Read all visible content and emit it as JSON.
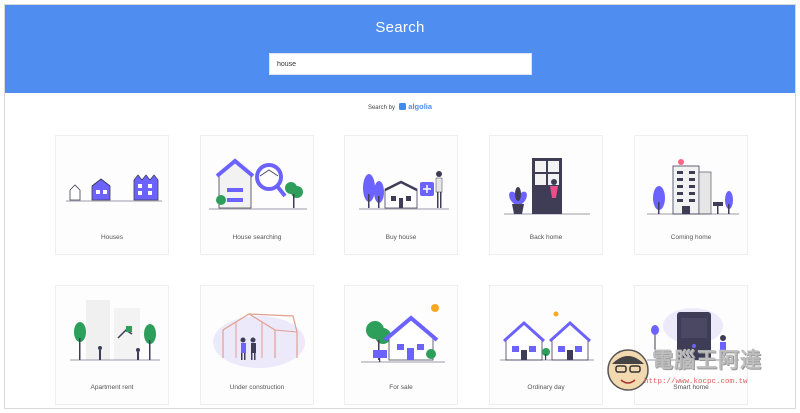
{
  "header": {
    "title": "Search",
    "search_value": "house"
  },
  "powered_by": {
    "prefix": "Search by",
    "brand": "algolia"
  },
  "colors": {
    "header_bg": "#4f8ef0",
    "illustration_accent": "#6c63ff"
  },
  "cards": [
    {
      "label": "Houses",
      "icon": "houses-icon"
    },
    {
      "label": "House searching",
      "icon": "house-searching-icon"
    },
    {
      "label": "Buy house",
      "icon": "buy-house-icon"
    },
    {
      "label": "Back home",
      "icon": "back-home-icon"
    },
    {
      "label": "Coming home",
      "icon": "coming-home-icon"
    },
    {
      "label": "Apartment rent",
      "icon": "apartment-rent-icon"
    },
    {
      "label": "Under construction",
      "icon": "under-construction-icon"
    },
    {
      "label": "For sale",
      "icon": "for-sale-icon"
    },
    {
      "label": "Ordinary day",
      "icon": "ordinary-day-icon"
    },
    {
      "label": "Smart home",
      "icon": "smart-home-icon"
    }
  ],
  "watermark": {
    "title": "電腦王阿達",
    "url": "http://www.kocpc.com.tw"
  }
}
